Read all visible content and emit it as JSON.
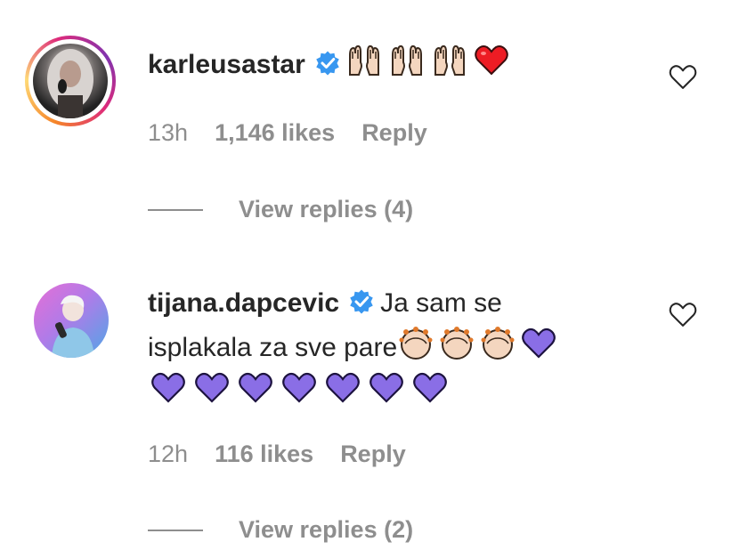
{
  "comments": [
    {
      "username": "karleusastar",
      "text": "",
      "emoji_sequence": [
        "raising-hands",
        "raising-hands",
        "raising-hands",
        "red-heart"
      ],
      "time": "13h",
      "likes": "1,146 likes",
      "reply_label": "Reply",
      "view_replies": "View replies (4)",
      "avatar_story_ring": true
    },
    {
      "username": "tijana.dapcevic",
      "text_line1": "Ja sam se",
      "text_line2": "isplakala za sve pare",
      "emoji_line2": [
        "clapping-hands",
        "clapping-hands",
        "clapping-hands",
        "purple-heart"
      ],
      "emoji_line3": [
        "purple-heart",
        "purple-heart",
        "purple-heart",
        "purple-heart",
        "purple-heart",
        "purple-heart",
        "purple-heart"
      ],
      "time": "12h",
      "likes": "116 likes",
      "reply_label": "Reply",
      "view_replies": "View replies (2)",
      "avatar_story_ring": false
    }
  ],
  "colors": {
    "text": "#262626",
    "muted": "#8e8e8e",
    "verified": "#3897f0",
    "red_heart": "#ed1c24",
    "purple_heart": "#8a6ee6"
  },
  "icons": [
    "verified-badge-icon",
    "like-heart-outline-icon"
  ]
}
